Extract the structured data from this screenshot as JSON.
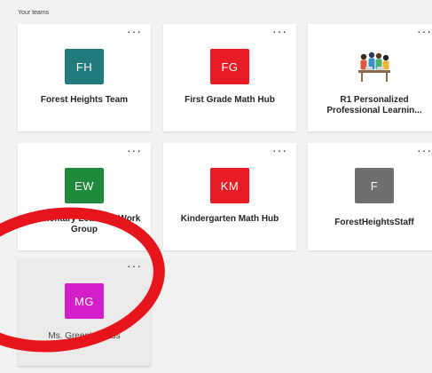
{
  "section": {
    "title": "Your teams"
  },
  "more_glyph": "···",
  "teams": [
    {
      "name": "Forest Heights Team",
      "initials": "FH",
      "color": "#217b7c"
    },
    {
      "name": "First Grade Math Hub",
      "initials": "FG",
      "color": "#e81c24"
    },
    {
      "name": "R1 Personalized Professional Learnin...",
      "initials": "",
      "icon": "people-meeting-icon"
    },
    {
      "name": "Elementary Learning Work Group",
      "initials": "EW",
      "color": "#208a3c"
    },
    {
      "name": "Kindergarten Math Hub",
      "initials": "KM",
      "color": "#e81c24"
    },
    {
      "name": "ForestHeightsStaff",
      "initials": "F",
      "color": "#6f6f6f"
    },
    {
      "name": "Ms. Green's Class",
      "initials": "MG",
      "color": "#d41ec9"
    }
  ],
  "annotation": {
    "color": "#e8141c"
  }
}
